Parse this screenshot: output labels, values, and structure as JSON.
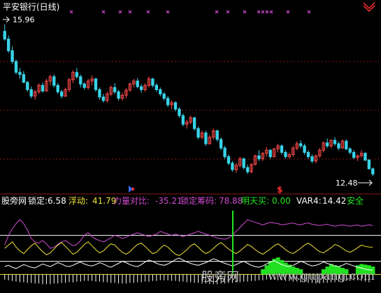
{
  "colors": {
    "background": "#000000",
    "up": "#ff4a4a",
    "down": "#39d3e8",
    "grid": "#8a1a1a",
    "axis": "#b8b8b8",
    "magenta": "#d04bd0",
    "yellow": "#f2e63a",
    "white": "#ffffff",
    "green": "#22e622",
    "greenFill": "#20e020",
    "cyanThin": "#3bd6e6",
    "red": "#ff3030",
    "title": "#ffffff"
  },
  "icons": {
    "expand": "up-arrow-icon",
    "signal": "dollar-signal-icon",
    "top_marks": "cross-mark-icon"
  },
  "header": {
    "title": "平安银行(日线)",
    "high_label": "15.96",
    "low_label": "12.48"
  },
  "indicator": {
    "name": "股旁网",
    "items": [
      {
        "label": "锁定:",
        "value": "6.58"
      },
      {
        "label": "浮动:",
        "value": "41.79"
      },
      {
        "label": "力量对比:",
        "value": "-35.21"
      },
      {
        "label": "锁定筹码:",
        "value": "78.88"
      },
      {
        "label": "明天买:",
        "value": "0.00"
      },
      {
        "label": "VAR4:",
        "value": "14.42"
      },
      {
        "label": "安全",
        "value": ""
      }
    ]
  },
  "watermark": {
    "cn": "股旁网",
    "en": "www.gupang.com"
  },
  "chart_data": [
    {
      "type": "candlestick",
      "title": "平安银行(日线)",
      "annotations": [
        "15.96",
        "12.48"
      ],
      "y_range": [
        12.2,
        16.2
      ],
      "candles": [
        [
          15.8,
          15.96,
          15.58,
          15.62
        ],
        [
          15.62,
          15.7,
          15.3,
          15.35
        ],
        [
          15.35,
          15.45,
          15.05,
          15.1
        ],
        [
          15.1,
          15.15,
          14.8,
          14.85
        ],
        [
          14.85,
          14.95,
          14.7,
          14.8
        ],
        [
          14.8,
          14.88,
          14.6,
          14.62
        ],
        [
          14.62,
          14.65,
          14.4,
          14.45
        ],
        [
          14.45,
          14.52,
          14.25,
          14.3
        ],
        [
          14.3,
          14.45,
          14.22,
          14.4
        ],
        [
          14.4,
          14.6,
          14.35,
          14.55
        ],
        [
          14.55,
          14.62,
          14.38,
          14.42
        ],
        [
          14.42,
          14.7,
          14.4,
          14.65
        ],
        [
          14.65,
          14.8,
          14.55,
          14.75
        ],
        [
          14.75,
          14.8,
          14.5,
          14.55
        ],
        [
          14.55,
          14.6,
          14.35,
          14.4
        ],
        [
          14.4,
          14.45,
          14.25,
          14.3
        ],
        [
          14.3,
          14.5,
          14.28,
          14.45
        ],
        [
          14.45,
          14.72,
          14.4,
          14.68
        ],
        [
          14.68,
          14.9,
          14.6,
          14.85
        ],
        [
          14.85,
          14.95,
          14.7,
          14.75
        ],
        [
          14.75,
          14.8,
          14.5,
          14.58
        ],
        [
          14.58,
          14.62,
          14.45,
          14.5
        ],
        [
          14.5,
          14.7,
          14.45,
          14.65
        ],
        [
          14.65,
          14.78,
          14.55,
          14.7
        ],
        [
          14.7,
          14.72,
          14.4,
          14.45
        ],
        [
          14.45,
          14.5,
          14.22,
          14.28
        ],
        [
          14.28,
          14.35,
          14.15,
          14.2
        ],
        [
          14.2,
          14.4,
          14.15,
          14.35
        ],
        [
          14.35,
          14.55,
          14.3,
          14.5
        ],
        [
          14.5,
          14.6,
          14.35,
          14.4
        ],
        [
          14.4,
          14.45,
          14.2,
          14.25
        ],
        [
          14.25,
          14.38,
          14.2,
          14.32
        ],
        [
          14.32,
          14.48,
          14.25,
          14.44
        ],
        [
          14.44,
          14.62,
          14.4,
          14.58
        ],
        [
          14.58,
          14.7,
          14.5,
          14.65
        ],
        [
          14.65,
          14.72,
          14.48,
          14.52
        ],
        [
          14.52,
          14.58,
          14.38,
          14.45
        ],
        [
          14.45,
          14.6,
          14.4,
          14.55
        ],
        [
          14.55,
          14.75,
          14.5,
          14.7
        ],
        [
          14.7,
          14.72,
          14.5,
          14.55
        ],
        [
          14.55,
          14.6,
          14.4,
          14.45
        ],
        [
          14.45,
          14.5,
          14.3,
          14.35
        ],
        [
          14.35,
          14.4,
          14.2,
          14.25
        ],
        [
          14.25,
          14.3,
          14.05,
          14.1
        ],
        [
          14.1,
          14.2,
          14.0,
          14.15
        ],
        [
          14.15,
          14.18,
          13.95,
          14.0
        ],
        [
          14.0,
          14.05,
          13.8,
          13.85
        ],
        [
          13.85,
          13.9,
          13.6,
          13.65
        ],
        [
          13.65,
          13.75,
          13.55,
          13.7
        ],
        [
          13.7,
          13.85,
          13.65,
          13.8
        ],
        [
          13.8,
          13.82,
          13.5,
          13.55
        ],
        [
          13.55,
          13.6,
          13.3,
          13.35
        ],
        [
          13.35,
          13.5,
          13.3,
          13.45
        ],
        [
          13.45,
          13.5,
          13.15,
          13.2
        ],
        [
          13.2,
          13.4,
          13.18,
          13.35
        ],
        [
          13.35,
          13.55,
          13.3,
          13.5
        ],
        [
          13.5,
          13.52,
          13.25,
          13.3
        ],
        [
          13.3,
          13.35,
          13.05,
          13.1
        ],
        [
          13.1,
          13.15,
          12.85,
          12.9
        ],
        [
          12.9,
          12.95,
          12.7,
          12.75
        ],
        [
          12.75,
          12.8,
          12.55,
          12.6
        ],
        [
          12.6,
          12.75,
          12.52,
          12.7
        ],
        [
          12.7,
          12.9,
          12.65,
          12.85
        ],
        [
          12.85,
          12.88,
          12.6,
          12.65
        ],
        [
          12.65,
          12.72,
          12.5,
          12.55
        ],
        [
          12.55,
          12.75,
          12.52,
          12.72
        ],
        [
          12.72,
          12.95,
          12.7,
          12.92
        ],
        [
          12.92,
          13.05,
          12.8,
          12.85
        ],
        [
          12.85,
          13.0,
          12.8,
          12.98
        ],
        [
          12.98,
          13.12,
          12.9,
          13.05
        ],
        [
          13.05,
          13.08,
          12.85,
          12.9
        ],
        [
          12.9,
          13.1,
          12.88,
          13.08
        ],
        [
          13.08,
          13.2,
          13.0,
          13.15
        ],
        [
          13.15,
          13.18,
          12.95,
          13.0
        ],
        [
          13.0,
          13.05,
          12.85,
          12.9
        ],
        [
          12.9,
          13.0,
          12.85,
          12.95
        ],
        [
          12.95,
          13.15,
          12.9,
          13.1
        ],
        [
          13.1,
          13.25,
          13.05,
          13.2
        ],
        [
          13.2,
          13.28,
          13.1,
          13.15
        ],
        [
          13.15,
          13.2,
          12.95,
          13.0
        ],
        [
          13.0,
          13.05,
          12.85,
          12.9
        ],
        [
          12.9,
          12.95,
          12.75,
          12.8
        ],
        [
          12.8,
          12.95,
          12.75,
          12.92
        ],
        [
          12.92,
          13.1,
          12.88,
          13.05
        ],
        [
          13.05,
          13.25,
          13.0,
          13.22
        ],
        [
          13.22,
          13.32,
          13.1,
          13.15
        ],
        [
          13.15,
          13.3,
          13.1,
          13.28
        ],
        [
          13.28,
          13.35,
          13.15,
          13.2
        ],
        [
          13.2,
          13.25,
          13.05,
          13.1
        ],
        [
          13.1,
          13.3,
          13.08,
          13.26
        ],
        [
          13.26,
          13.3,
          13.05,
          13.08
        ],
        [
          13.08,
          13.12,
          12.95,
          13.0
        ],
        [
          13.0,
          13.05,
          12.85,
          12.88
        ],
        [
          12.88,
          12.95,
          12.8,
          12.92
        ],
        [
          12.92,
          13.05,
          12.88,
          12.98
        ],
        [
          12.98,
          13.0,
          12.8,
          12.82
        ],
        [
          12.82,
          12.85,
          12.6,
          12.62
        ],
        [
          12.62,
          12.65,
          12.45,
          12.5
        ]
      ],
      "markers": {
        "top_cross_count": 15,
        "signal_symbol": "$"
      }
    },
    {
      "type": "line",
      "title": "股旁网",
      "y_range": [
        -20,
        100
      ],
      "series": [
        {
          "name": "锁定",
          "values": [
            12,
            14,
            11,
            9,
            12,
            15,
            13,
            11,
            10,
            13,
            16,
            14,
            12,
            15,
            18,
            16,
            13,
            12,
            14,
            17,
            19,
            16,
            14,
            13,
            15,
            18,
            16,
            13,
            11,
            14,
            17,
            20,
            18,
            15,
            13,
            12,
            15,
            19,
            22,
            20,
            17,
            15,
            14,
            16,
            19,
            23,
            25,
            22,
            19,
            17,
            15,
            14,
            16,
            18,
            21,
            24,
            22,
            19,
            17,
            15,
            13,
            15,
            18,
            20,
            17,
            14,
            12,
            11,
            13,
            16,
            19,
            21,
            18,
            15,
            13,
            12,
            14,
            17,
            20,
            18,
            15,
            13,
            14,
            16,
            19,
            17,
            15,
            13,
            12,
            14,
            17,
            15,
            13,
            11,
            10,
            8,
            7,
            6.58
          ]
        },
        {
          "name": "浮动",
          "values": [
            40,
            45,
            50,
            42,
            36,
            32,
            38,
            44,
            48,
            41,
            35,
            30,
            33,
            39,
            45,
            49,
            43,
            37,
            31,
            34,
            40,
            46,
            50,
            44,
            38,
            33,
            36,
            42,
            47,
            45,
            39,
            34,
            31,
            35,
            41,
            46,
            48,
            43,
            37,
            32,
            34,
            40,
            45,
            42,
            36,
            31,
            29,
            33,
            38,
            44,
            47,
            42,
            36,
            32,
            35,
            40,
            45,
            49,
            44,
            39,
            35,
            32,
            36,
            41,
            46,
            43,
            38,
            34,
            31,
            35,
            39,
            44,
            47,
            43,
            38,
            34,
            32,
            36,
            40,
            45,
            48,
            44,
            39,
            35,
            33,
            37,
            41,
            46,
            44,
            40,
            36,
            34,
            37,
            41,
            45,
            43,
            42,
            41.79
          ]
        },
        {
          "name": "力量对比",
          "values": [
            45,
            60,
            70,
            78,
            84,
            78,
            68,
            55,
            50,
            48,
            52,
            47,
            40,
            42,
            46,
            50,
            52,
            48,
            44,
            46,
            52,
            60,
            64,
            58,
            54,
            52,
            50,
            53,
            56,
            60,
            58,
            55,
            57,
            60,
            62,
            64,
            62,
            60,
            58,
            60,
            62,
            66,
            64,
            62,
            60,
            62,
            60,
            58,
            60,
            62,
            64,
            66,
            64,
            62,
            60,
            58,
            56,
            55,
            54,
            56,
            60,
            66,
            72,
            78,
            84,
            82,
            80,
            78,
            76,
            78,
            80,
            79,
            78,
            76,
            77,
            78,
            79,
            77,
            76,
            78,
            79,
            77,
            76,
            75,
            76,
            77,
            75,
            74,
            75,
            76,
            75,
            74,
            75,
            76,
            74,
            75,
            76,
            75
          ]
        },
        {
          "name": "锁定筹码",
          "values": [
            0,
            0,
            0,
            0,
            0,
            0,
            0,
            0,
            0,
            0,
            0,
            0,
            0,
            0,
            0,
            0,
            0,
            0,
            0,
            0,
            0,
            0,
            0,
            0,
            0,
            0,
            0,
            0,
            0,
            0,
            0,
            0,
            0,
            0,
            0,
            0,
            0,
            0,
            0,
            0,
            0,
            0,
            0,
            0,
            0,
            0,
            0,
            0,
            0,
            0,
            0,
            0,
            0,
            0,
            0,
            0,
            0,
            0,
            0,
            0,
            0,
            0,
            0,
            0,
            0,
            0,
            0,
            0,
            8,
            14,
            20,
            24,
            26,
            22,
            18,
            15,
            12,
            10,
            8,
            0,
            0,
            0,
            0,
            0,
            8,
            12,
            16,
            14,
            12,
            10,
            8,
            0,
            0,
            14,
            16,
            15,
            14,
            12
          ]
        },
        {
          "name": "明天买",
          "values": [
            0,
            0,
            0,
            0,
            0,
            0,
            0,
            0,
            0,
            0,
            0,
            0,
            0,
            0,
            0,
            0,
            0,
            0,
            0,
            0,
            0,
            0,
            0,
            0,
            0,
            0,
            0,
            0,
            0,
            0,
            0,
            0,
            0,
            0,
            0,
            0,
            0,
            0,
            0,
            0,
            0,
            0,
            0,
            0,
            0,
            0,
            0,
            0,
            0,
            0,
            0,
            0,
            0,
            0,
            0,
            0,
            0,
            0,
            0,
            0,
            0,
            0,
            0,
            0,
            0,
            0,
            0,
            0,
            0,
            0,
            0,
            0,
            0,
            0,
            0,
            0,
            0,
            0,
            0,
            0,
            0,
            0,
            0,
            0,
            0,
            0,
            0,
            0,
            0,
            0,
            0,
            0,
            0,
            0,
            0,
            0,
            0,
            0
          ]
        },
        {
          "name": "VAR4",
          "values": [
            -8,
            -9,
            -10,
            -11,
            -12,
            -12,
            -13,
            -13,
            -14,
            -14,
            -15,
            -15,
            -15,
            -14,
            -14,
            -13,
            -13,
            -12,
            -12,
            -11,
            -11,
            -10,
            -10,
            -10,
            -11,
            -11,
            -12,
            -12,
            -13,
            -13,
            -14,
            -14,
            -14,
            -13,
            -13,
            -12,
            -12,
            -11,
            -11,
            -10,
            -10,
            -9,
            -9,
            -9,
            -10,
            -10,
            -11,
            -11,
            -12,
            -12,
            -13,
            -13,
            -14,
            -14,
            -15,
            -15,
            -15,
            -14,
            -14,
            -13,
            -13,
            -12,
            -12,
            -11,
            -11,
            -10,
            -10,
            -9,
            -9,
            -8,
            -8,
            -8,
            -9,
            -9,
            -10,
            -10,
            -11,
            -11,
            -12,
            -12,
            -13,
            -13,
            -14,
            -14,
            -13,
            -13,
            -12,
            -12,
            -11,
            -11,
            -10,
            -10,
            -9,
            -9,
            -10,
            -11,
            -12,
            14.42
          ]
        }
      ]
    }
  ]
}
